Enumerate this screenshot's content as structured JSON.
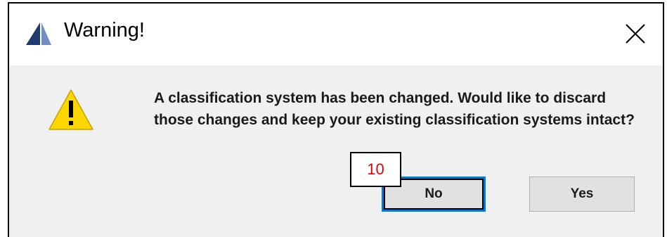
{
  "dialog": {
    "title": "Warning!",
    "message": "A classification system has been changed. Would like to discard those changes and keep your existing classification systems intact?",
    "buttons": {
      "no_label": "No",
      "yes_label": "Yes"
    },
    "focused_button": "No"
  },
  "callout": {
    "label": "10",
    "color": "#e00000"
  },
  "icons": {
    "app": "app-logo-icon",
    "close": "close-icon",
    "warning": "warning-icon"
  },
  "colors": {
    "focus_border": "#0078d7",
    "warning_fill": "#ffd700"
  }
}
